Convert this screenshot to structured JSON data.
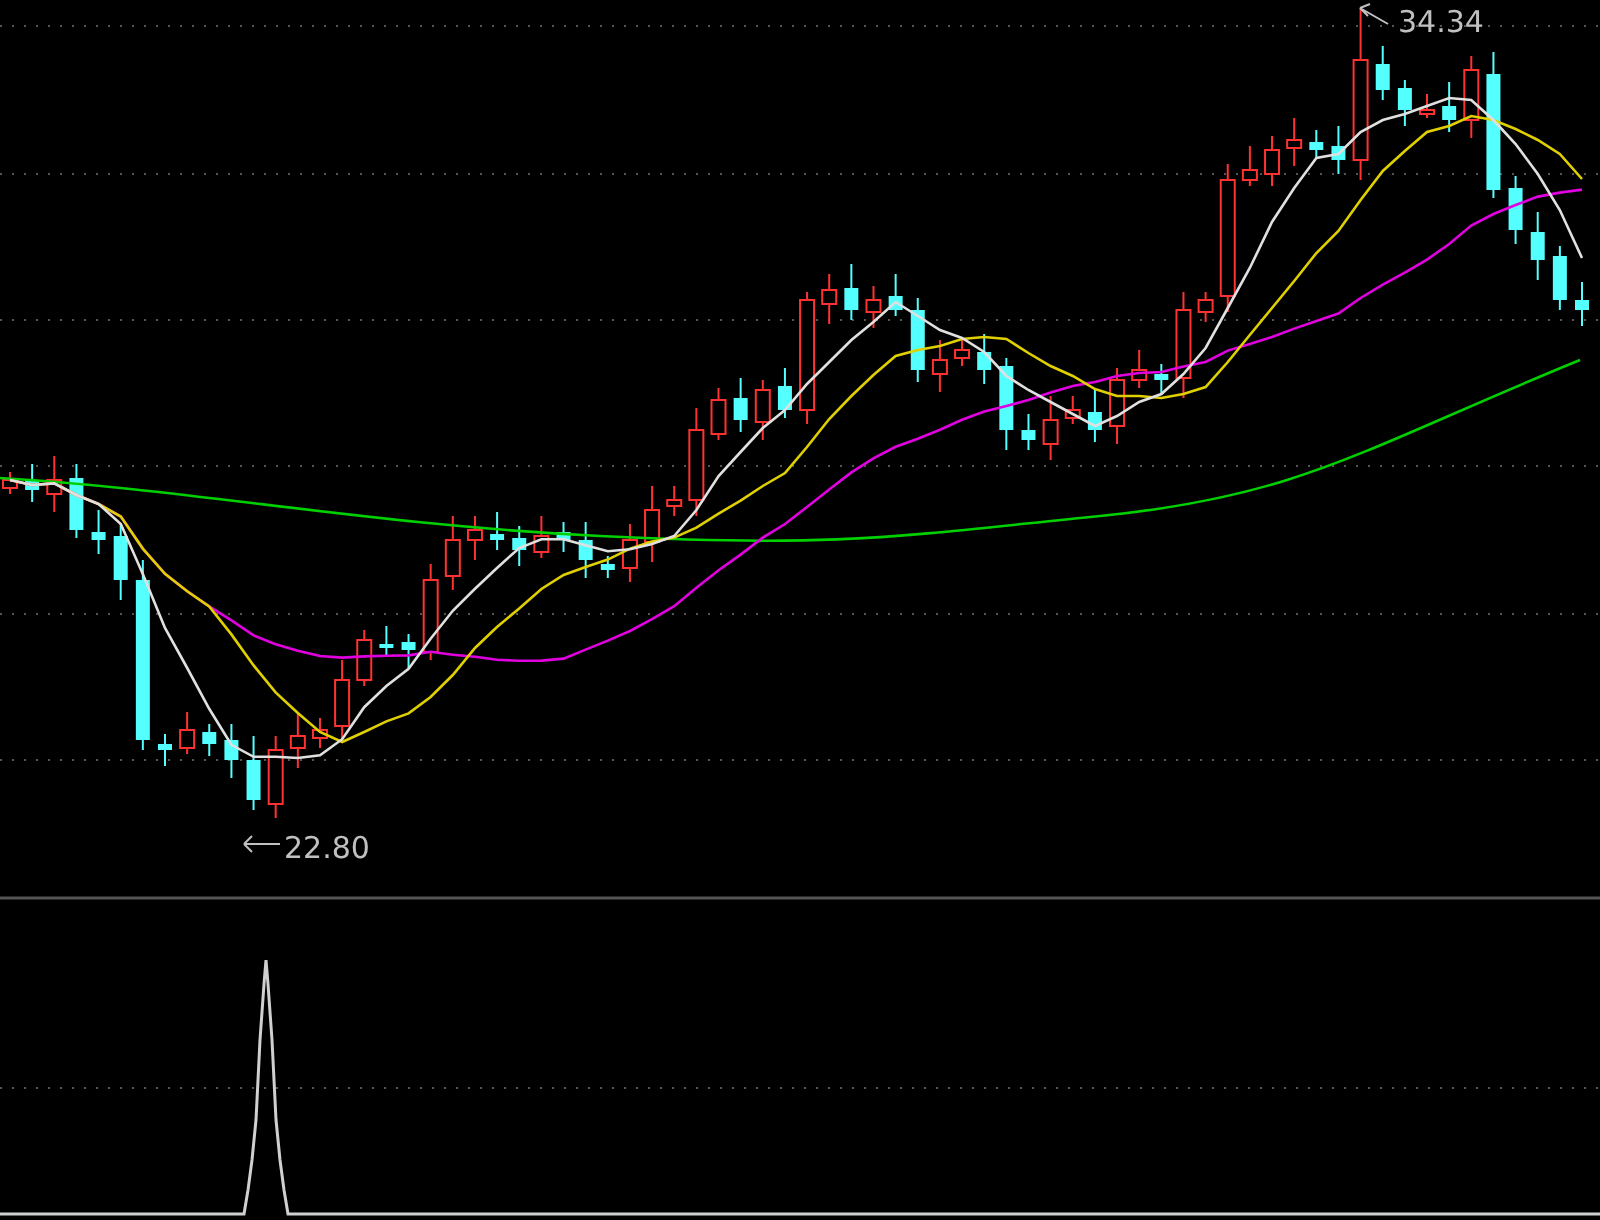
{
  "price_chart": {
    "high_label": "34.34",
    "low_label": "22.80"
  }
}
